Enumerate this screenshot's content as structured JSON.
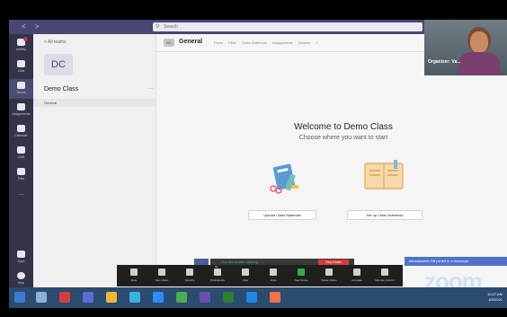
{
  "search": {
    "placeholder": "Search"
  },
  "rail": [
    {
      "label": "Activity",
      "badge": true
    },
    {
      "label": "Chat"
    },
    {
      "label": "Teams",
      "active": true
    },
    {
      "label": "Assignments"
    },
    {
      "label": "Calendar"
    },
    {
      "label": "Calls"
    },
    {
      "label": "Files"
    },
    {
      "label": "..."
    },
    {
      "label": "Apps"
    },
    {
      "label": "Help"
    }
  ],
  "chanlist": {
    "back": "< All teams",
    "avatar": "DC",
    "team_name": "Demo Class",
    "more": "...",
    "channel": "General"
  },
  "header": {
    "channel_icon": "DC",
    "title": "General",
    "tabs": [
      "Posts",
      "Files",
      "Class Notebook",
      "Assignments",
      "Grades",
      "+"
    ]
  },
  "welcome": {
    "title": "Welcome to Demo Class",
    "subtitle": "Choose where you want to start",
    "btn_upload": "Upload Class Materials",
    "btn_notebook": "Set up Class Notebook"
  },
  "video": {
    "name": "Organizer: Va..."
  },
  "recording": {
    "label": "You are screen sharing",
    "stop": "Stop Share"
  },
  "notice": "Jathalakshmi Gill joined in a message",
  "zoombar": [
    {
      "label": "Mute",
      "icon": "mic-icon"
    },
    {
      "label": "Stop Video",
      "icon": "video-icon"
    },
    {
      "label": "Security",
      "icon": "shield-icon"
    },
    {
      "label": "Participants",
      "icon": "participants-icon",
      "count": "58"
    },
    {
      "label": "Chat",
      "icon": "chat-icon"
    },
    {
      "label": "Polls",
      "icon": "poll-icon"
    },
    {
      "label": "New Share",
      "icon": "share-icon",
      "green": true
    },
    {
      "label": "Pause Share",
      "icon": "pause-icon"
    },
    {
      "label": "Annotate",
      "icon": "annotate-icon"
    },
    {
      "label": "Remote Control",
      "icon": "remote-icon"
    }
  ],
  "zoom_logo": "zoom",
  "taskbar": {
    "time": "10:27 AM",
    "date": "4/5/2021"
  },
  "colors": {
    "teams_purple": "#464775",
    "rail": "#33344a",
    "zoom_green": "#2bb24c",
    "stop_red": "#d83b3b"
  }
}
